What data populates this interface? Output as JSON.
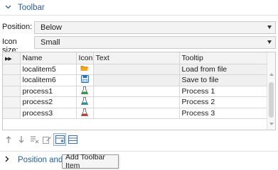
{
  "section_toolbar": {
    "title": "Toolbar"
  },
  "form": {
    "position_label": "Position:",
    "position_value": "Below",
    "icon_size_label": "Icon size:",
    "icon_size_value": "Small"
  },
  "table": {
    "columns": [
      "Name",
      "Icon",
      "Text",
      "Tooltip"
    ],
    "rows": [
      {
        "name": "localitem5",
        "icon": "folder-open-icon",
        "text": "",
        "tooltip": "Load from file"
      },
      {
        "name": "localitem6",
        "icon": "save-disk-icon",
        "text": "",
        "tooltip": "Save to file"
      },
      {
        "name": "process1",
        "icon": "flask-green-icon",
        "text": "",
        "tooltip": "Process 1"
      },
      {
        "name": "process2",
        "icon": "flask-teal-icon",
        "text": "",
        "tooltip": "Process 2"
      },
      {
        "name": "process3",
        "icon": "flask-red-icon",
        "text": "",
        "tooltip": "Process 3"
      }
    ]
  },
  "toolbar_buttons": [
    "move-up-icon",
    "move-down-icon",
    "delete-rows-icon",
    "edit-icon",
    "add-toolbar-item-icon",
    "add-separator-icon"
  ],
  "section_position": {
    "title": "Position and S"
  },
  "tooltip": {
    "text": "Add Toolbar Item"
  },
  "colors": {
    "section_title": "#2c5d96",
    "folder": "#f5a623",
    "save": "#2e6db4",
    "flask_green": "#2e9b3a",
    "flask_teal": "#1a9aa0",
    "flask_red": "#c0392b"
  }
}
